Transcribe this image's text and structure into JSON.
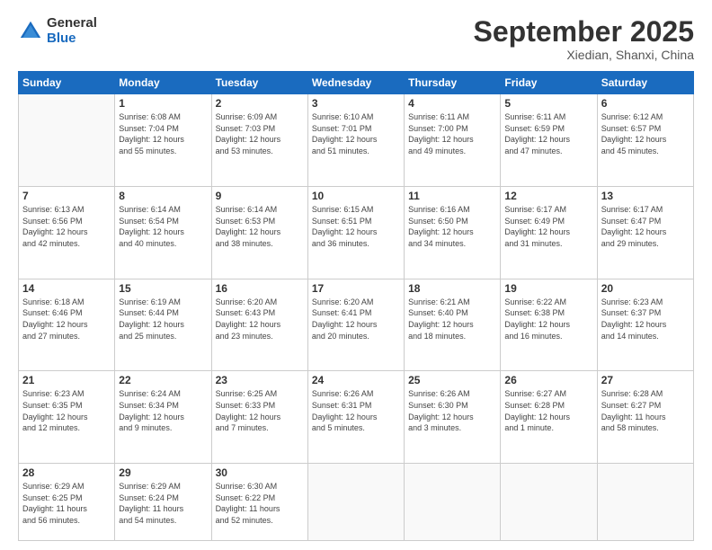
{
  "logo": {
    "general": "General",
    "blue": "Blue"
  },
  "header": {
    "month": "September 2025",
    "location": "Xiedian, Shanxi, China"
  },
  "days_of_week": [
    "Sunday",
    "Monday",
    "Tuesday",
    "Wednesday",
    "Thursday",
    "Friday",
    "Saturday"
  ],
  "weeks": [
    [
      {
        "day": "",
        "info": ""
      },
      {
        "day": "1",
        "info": "Sunrise: 6:08 AM\nSunset: 7:04 PM\nDaylight: 12 hours\nand 55 minutes."
      },
      {
        "day": "2",
        "info": "Sunrise: 6:09 AM\nSunset: 7:03 PM\nDaylight: 12 hours\nand 53 minutes."
      },
      {
        "day": "3",
        "info": "Sunrise: 6:10 AM\nSunset: 7:01 PM\nDaylight: 12 hours\nand 51 minutes."
      },
      {
        "day": "4",
        "info": "Sunrise: 6:11 AM\nSunset: 7:00 PM\nDaylight: 12 hours\nand 49 minutes."
      },
      {
        "day": "5",
        "info": "Sunrise: 6:11 AM\nSunset: 6:59 PM\nDaylight: 12 hours\nand 47 minutes."
      },
      {
        "day": "6",
        "info": "Sunrise: 6:12 AM\nSunset: 6:57 PM\nDaylight: 12 hours\nand 45 minutes."
      }
    ],
    [
      {
        "day": "7",
        "info": "Sunrise: 6:13 AM\nSunset: 6:56 PM\nDaylight: 12 hours\nand 42 minutes."
      },
      {
        "day": "8",
        "info": "Sunrise: 6:14 AM\nSunset: 6:54 PM\nDaylight: 12 hours\nand 40 minutes."
      },
      {
        "day": "9",
        "info": "Sunrise: 6:14 AM\nSunset: 6:53 PM\nDaylight: 12 hours\nand 38 minutes."
      },
      {
        "day": "10",
        "info": "Sunrise: 6:15 AM\nSunset: 6:51 PM\nDaylight: 12 hours\nand 36 minutes."
      },
      {
        "day": "11",
        "info": "Sunrise: 6:16 AM\nSunset: 6:50 PM\nDaylight: 12 hours\nand 34 minutes."
      },
      {
        "day": "12",
        "info": "Sunrise: 6:17 AM\nSunset: 6:49 PM\nDaylight: 12 hours\nand 31 minutes."
      },
      {
        "day": "13",
        "info": "Sunrise: 6:17 AM\nSunset: 6:47 PM\nDaylight: 12 hours\nand 29 minutes."
      }
    ],
    [
      {
        "day": "14",
        "info": "Sunrise: 6:18 AM\nSunset: 6:46 PM\nDaylight: 12 hours\nand 27 minutes."
      },
      {
        "day": "15",
        "info": "Sunrise: 6:19 AM\nSunset: 6:44 PM\nDaylight: 12 hours\nand 25 minutes."
      },
      {
        "day": "16",
        "info": "Sunrise: 6:20 AM\nSunset: 6:43 PM\nDaylight: 12 hours\nand 23 minutes."
      },
      {
        "day": "17",
        "info": "Sunrise: 6:20 AM\nSunset: 6:41 PM\nDaylight: 12 hours\nand 20 minutes."
      },
      {
        "day": "18",
        "info": "Sunrise: 6:21 AM\nSunset: 6:40 PM\nDaylight: 12 hours\nand 18 minutes."
      },
      {
        "day": "19",
        "info": "Sunrise: 6:22 AM\nSunset: 6:38 PM\nDaylight: 12 hours\nand 16 minutes."
      },
      {
        "day": "20",
        "info": "Sunrise: 6:23 AM\nSunset: 6:37 PM\nDaylight: 12 hours\nand 14 minutes."
      }
    ],
    [
      {
        "day": "21",
        "info": "Sunrise: 6:23 AM\nSunset: 6:35 PM\nDaylight: 12 hours\nand 12 minutes."
      },
      {
        "day": "22",
        "info": "Sunrise: 6:24 AM\nSunset: 6:34 PM\nDaylight: 12 hours\nand 9 minutes."
      },
      {
        "day": "23",
        "info": "Sunrise: 6:25 AM\nSunset: 6:33 PM\nDaylight: 12 hours\nand 7 minutes."
      },
      {
        "day": "24",
        "info": "Sunrise: 6:26 AM\nSunset: 6:31 PM\nDaylight: 12 hours\nand 5 minutes."
      },
      {
        "day": "25",
        "info": "Sunrise: 6:26 AM\nSunset: 6:30 PM\nDaylight: 12 hours\nand 3 minutes."
      },
      {
        "day": "26",
        "info": "Sunrise: 6:27 AM\nSunset: 6:28 PM\nDaylight: 12 hours\nand 1 minute."
      },
      {
        "day": "27",
        "info": "Sunrise: 6:28 AM\nSunset: 6:27 PM\nDaylight: 11 hours\nand 58 minutes."
      }
    ],
    [
      {
        "day": "28",
        "info": "Sunrise: 6:29 AM\nSunset: 6:25 PM\nDaylight: 11 hours\nand 56 minutes."
      },
      {
        "day": "29",
        "info": "Sunrise: 6:29 AM\nSunset: 6:24 PM\nDaylight: 11 hours\nand 54 minutes."
      },
      {
        "day": "30",
        "info": "Sunrise: 6:30 AM\nSunset: 6:22 PM\nDaylight: 11 hours\nand 52 minutes."
      },
      {
        "day": "",
        "info": ""
      },
      {
        "day": "",
        "info": ""
      },
      {
        "day": "",
        "info": ""
      },
      {
        "day": "",
        "info": ""
      }
    ]
  ]
}
